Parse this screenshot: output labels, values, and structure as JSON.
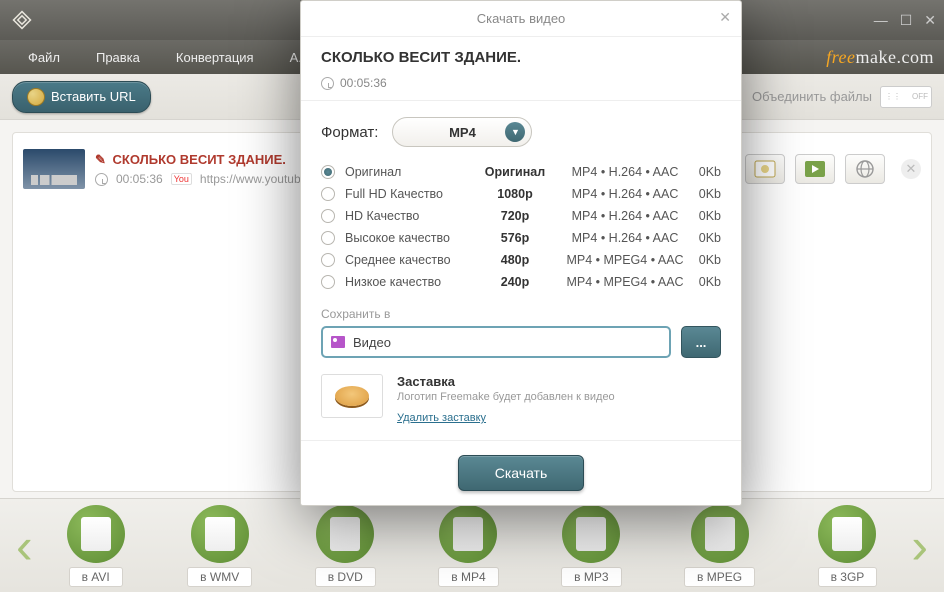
{
  "menubar": {
    "file": "Файл",
    "edit": "Правка",
    "convert": "Конвертация",
    "more": "А..."
  },
  "brand": {
    "fr": "free",
    "rest": "make.com"
  },
  "toolbar": {
    "paste_url": "Вставить URL",
    "join_files": "Объединить файлы",
    "join_toggle": "OFF"
  },
  "video": {
    "title": "СКОЛЬКО ВЕСИТ ЗДАНИЕ.",
    "duration": "00:05:36",
    "source_badge": "You",
    "url": "https://www.youtube"
  },
  "dock": {
    "items": [
      {
        "label": "в AVI"
      },
      {
        "label": "в WMV"
      },
      {
        "label": "в DVD"
      },
      {
        "label": "в MP4"
      },
      {
        "label": "в MP3"
      },
      {
        "label": "в MPEG"
      },
      {
        "label": "в 3GP"
      }
    ]
  },
  "dialog": {
    "title": "Скачать видео",
    "heading": "СКОЛЬКО ВЕСИТ ЗДАНИЕ.",
    "duration": "00:05:36",
    "format_label": "Формат:",
    "format_value": "MP4",
    "qualities": [
      {
        "name": "Оригинал",
        "res": "Оригинал",
        "codec": "MP4 • H.264 • AAC",
        "size": "0Kb",
        "selected": true
      },
      {
        "name": "Full HD Качество",
        "res": "1080p",
        "codec": "MP4 • H.264 • AAC",
        "size": "0Kb",
        "selected": false
      },
      {
        "name": "HD Качество",
        "res": "720p",
        "codec": "MP4 • H.264 • AAC",
        "size": "0Kb",
        "selected": false
      },
      {
        "name": "Высокое качество",
        "res": "576p",
        "codec": "MP4 • H.264 • AAC",
        "size": "0Kb",
        "selected": false
      },
      {
        "name": "Среднее качество",
        "res": "480p",
        "codec": "MP4 • MPEG4 • AAC",
        "size": "0Kb",
        "selected": false
      },
      {
        "name": "Низкое качество",
        "res": "240p",
        "codec": "MP4 • MPEG4 • AAC",
        "size": "0Kb",
        "selected": false
      }
    ],
    "save_label": "Сохранить в",
    "save_value": "Видео",
    "browse": "...",
    "splash_title": "Заставка",
    "splash_desc": "Логотип Freemake будет добавлен к видео",
    "splash_remove": "Удалить заставку",
    "download": "Скачать"
  }
}
